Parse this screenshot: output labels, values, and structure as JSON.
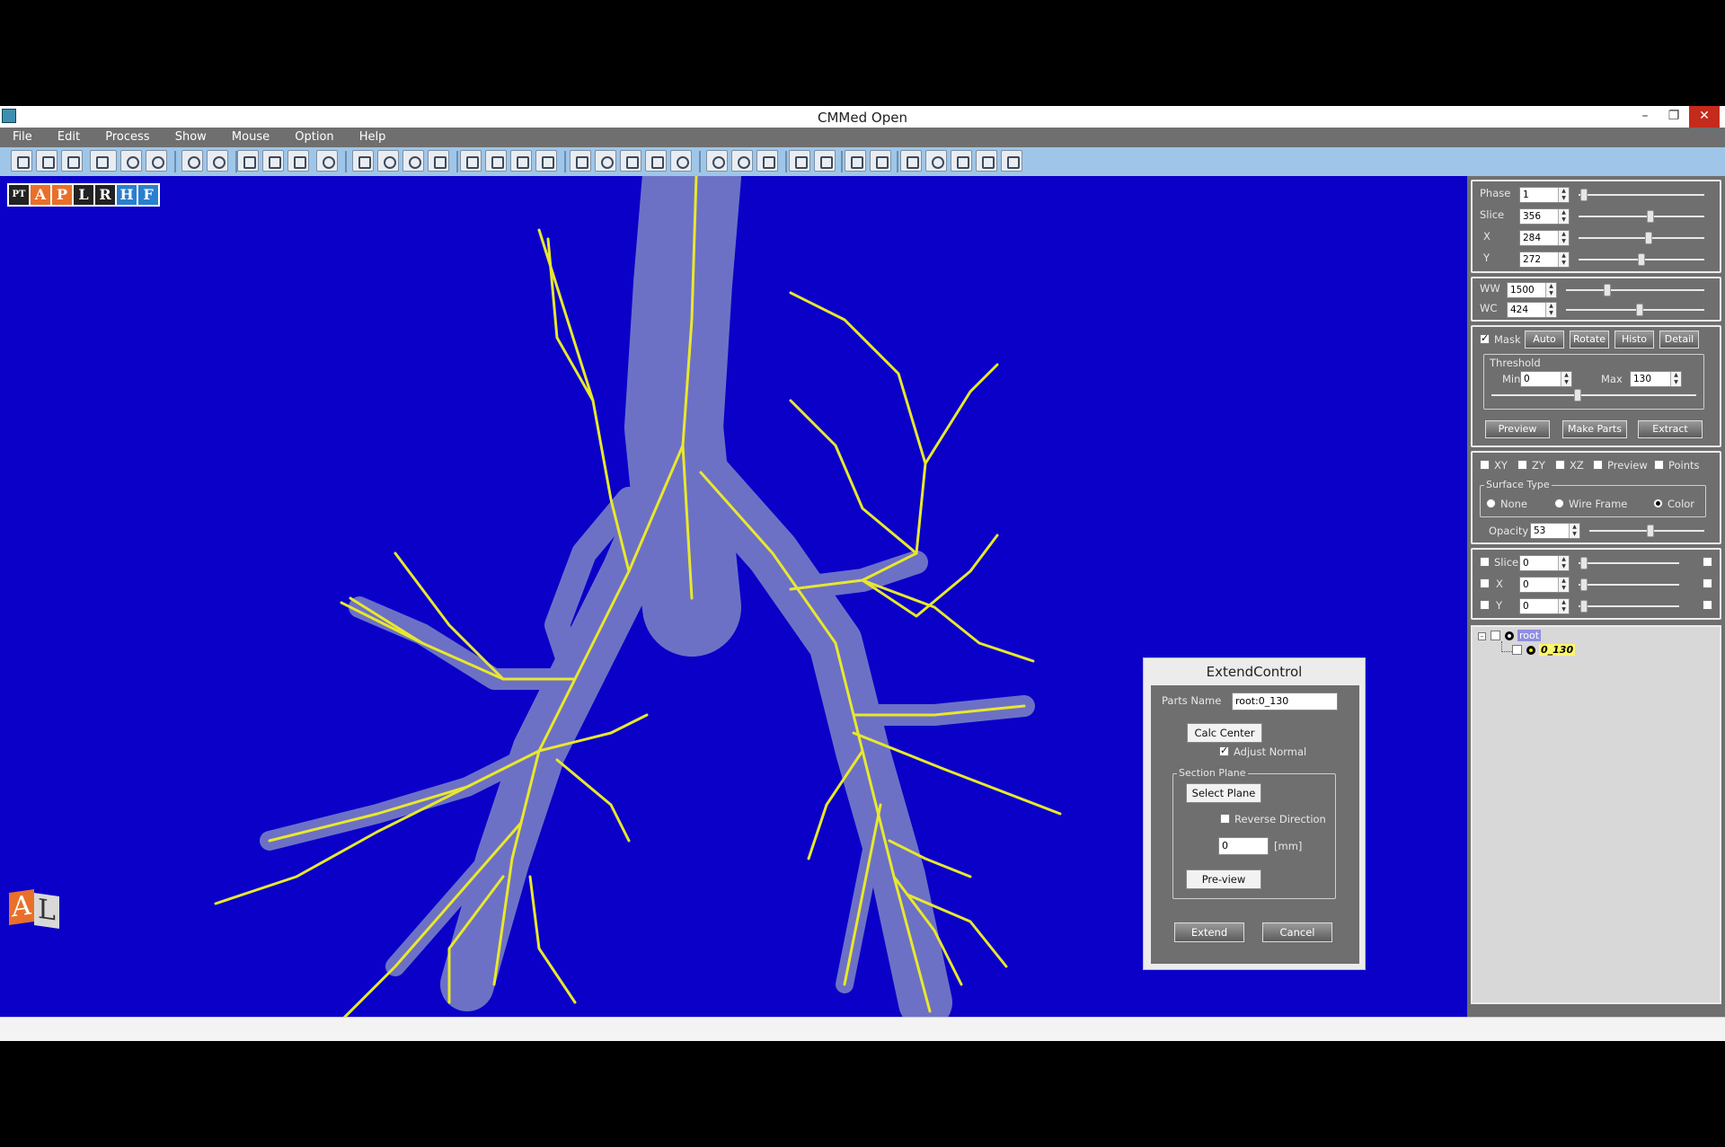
{
  "window": {
    "title": "CMMed  Open",
    "minimize": "–",
    "restore": "❐",
    "close": "✕"
  },
  "menu": [
    "File",
    "Edit",
    "Process",
    "Show",
    "Mouse",
    "Option",
    "Help"
  ],
  "orientation_buttons": [
    "PT",
    "A",
    "P",
    "L",
    "R",
    "H",
    "F"
  ],
  "logo": {
    "letters": [
      "A",
      "L"
    ]
  },
  "right_panel": {
    "phase": {
      "label": "Phase",
      "value": "1"
    },
    "slice": {
      "label": "Slice",
      "value": "356"
    },
    "x": {
      "label": "X",
      "value": "284"
    },
    "y": {
      "label": "Y",
      "value": "272"
    },
    "ww": {
      "label": "WW",
      "value": "1500"
    },
    "wc": {
      "label": "WC",
      "value": "424"
    },
    "mask": {
      "label": "Mask",
      "checked": true,
      "buttons": [
        "Auto",
        "Rotate",
        "Histo",
        "Detail"
      ]
    },
    "threshold": {
      "legend": "Threshold",
      "min_label": "Min",
      "min_value": "0",
      "max_label": "Max",
      "max_value": "130"
    },
    "actions": [
      "Preview",
      "Make Parts",
      "Extract"
    ],
    "views": [
      "XY",
      "ZY",
      "XZ",
      "Preview",
      "Points"
    ],
    "surface_type": {
      "legend": "Surface Type",
      "options": [
        "None",
        "Wire Frame",
        "Color"
      ],
      "selected": "Color"
    },
    "opacity": {
      "label": "Opacity",
      "value": "53"
    },
    "clip_slice": {
      "label": "Slice",
      "value": "0"
    },
    "clip_x": {
      "label": "X",
      "value": "0"
    },
    "clip_y": {
      "label": "Y",
      "value": "0"
    },
    "tree": {
      "root": "root",
      "child": "0_130"
    }
  },
  "dialog": {
    "title": "ExtendControl",
    "parts_name_label": "Parts Name",
    "parts_name_value": "root:0_130",
    "calc_center": "Calc Center",
    "adjust_normal": "Adjust Normal",
    "section_plane": "Section Plane",
    "select_plane": "Select Plane",
    "reverse_direction": "Reverse Direction",
    "offset_value": "0",
    "unit": "[mm]",
    "preview": "Pre-view",
    "extend": "Extend",
    "cancel": "Cancel"
  }
}
